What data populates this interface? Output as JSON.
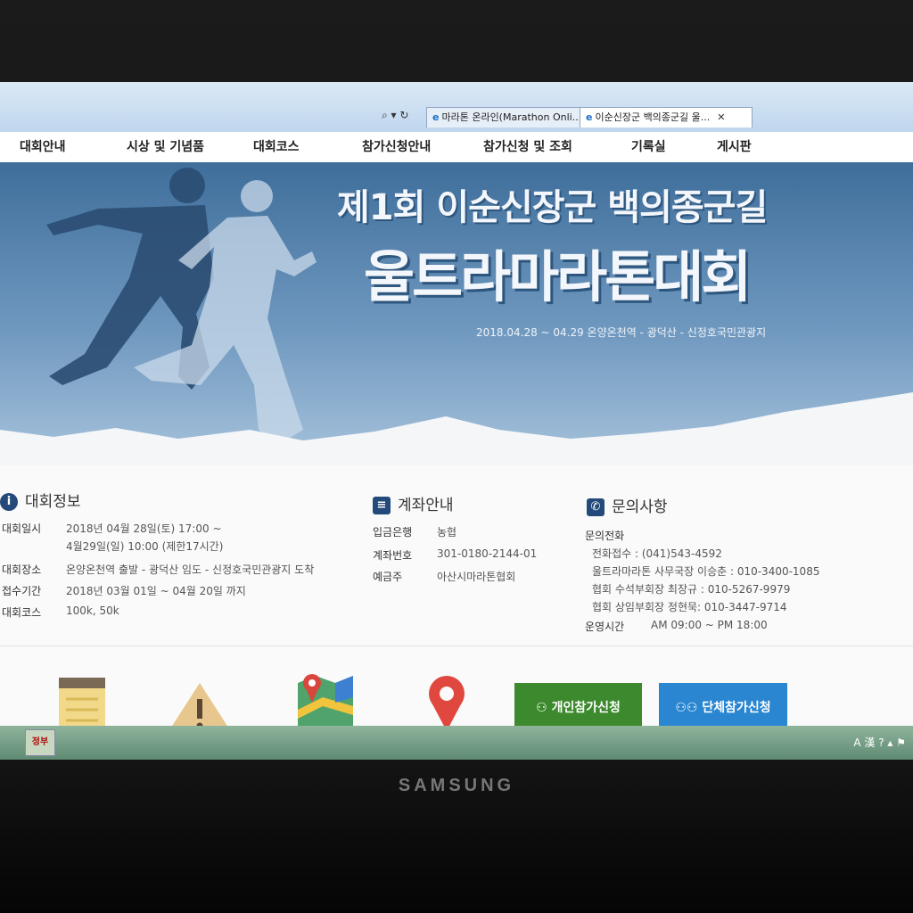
{
  "browser": {
    "address_icons": "⌕ ▾ ↻",
    "tabs": [
      {
        "label": "마라톤 온라인(Marathon Onli..."
      },
      {
        "label": "이순신장군 백의종군길 울..."
      }
    ]
  },
  "nav": {
    "items": [
      "대회안내",
      "시상 및 기념품",
      "대회코스",
      "참가신청안내",
      "참가신청 및 조회",
      "기록실",
      "게시판"
    ]
  },
  "banner": {
    "title_line1": "제1회 이순신장군 백의종군길",
    "title_line2": "울트라마라톤대회",
    "subtitle": "2018.04.28 ~ 04.29  온양온천역 - 광덕산 - 신정호국민관광지"
  },
  "info": {
    "title": "대회정보",
    "rows": [
      {
        "label": "대회일시",
        "value": "2018년 04월 28일(토) 17:00 ~",
        "value2": "4월29일(일) 10:00 (제한17시간)"
      },
      {
        "label": "대회장소",
        "value": "온양온천역 출발 - 광덕산 임도 - 신정호국민관광지 도착"
      },
      {
        "label": "접수기간",
        "value": "2018년 03월 01일 ~ 04월 20일 까지"
      },
      {
        "label": "대회코스",
        "value": "100k, 50k"
      }
    ]
  },
  "account": {
    "title": "계좌안내",
    "rows": [
      {
        "label": "입금은행",
        "value": "농협"
      },
      {
        "label": "계좌번호",
        "value": "301-0180-2144-01"
      },
      {
        "label": "예금주",
        "value": "아산시마라톤협회"
      }
    ]
  },
  "contact": {
    "title": "문의사항",
    "phone_heading": "문의전화",
    "lines": [
      "전화접수 : (041)543-4592",
      "울트라마라톤 사무국장 이승춘 : 010-3400-1085",
      "협회 수석부회장 최장규 : 010-5267-9979",
      "협회 상임부회장 정현묵: 010-3447-9714"
    ],
    "hours_label": "운영시간",
    "hours_value": "AM 09:00 ~ PM 18:00"
  },
  "actions": {
    "individual": "개인참가신청",
    "group": "단체참가신청"
  },
  "taskbar": {
    "app_label": "정부",
    "tray_text": "A 漢 ? ▴ ⚑"
  },
  "monitor": {
    "brand": "SAMSUNG"
  },
  "colors": {
    "banner_blue": "#3f6e9b",
    "icon_navy": "#234a7a",
    "individual_button": "#3c8a2d",
    "group_button": "#2a86d1"
  }
}
